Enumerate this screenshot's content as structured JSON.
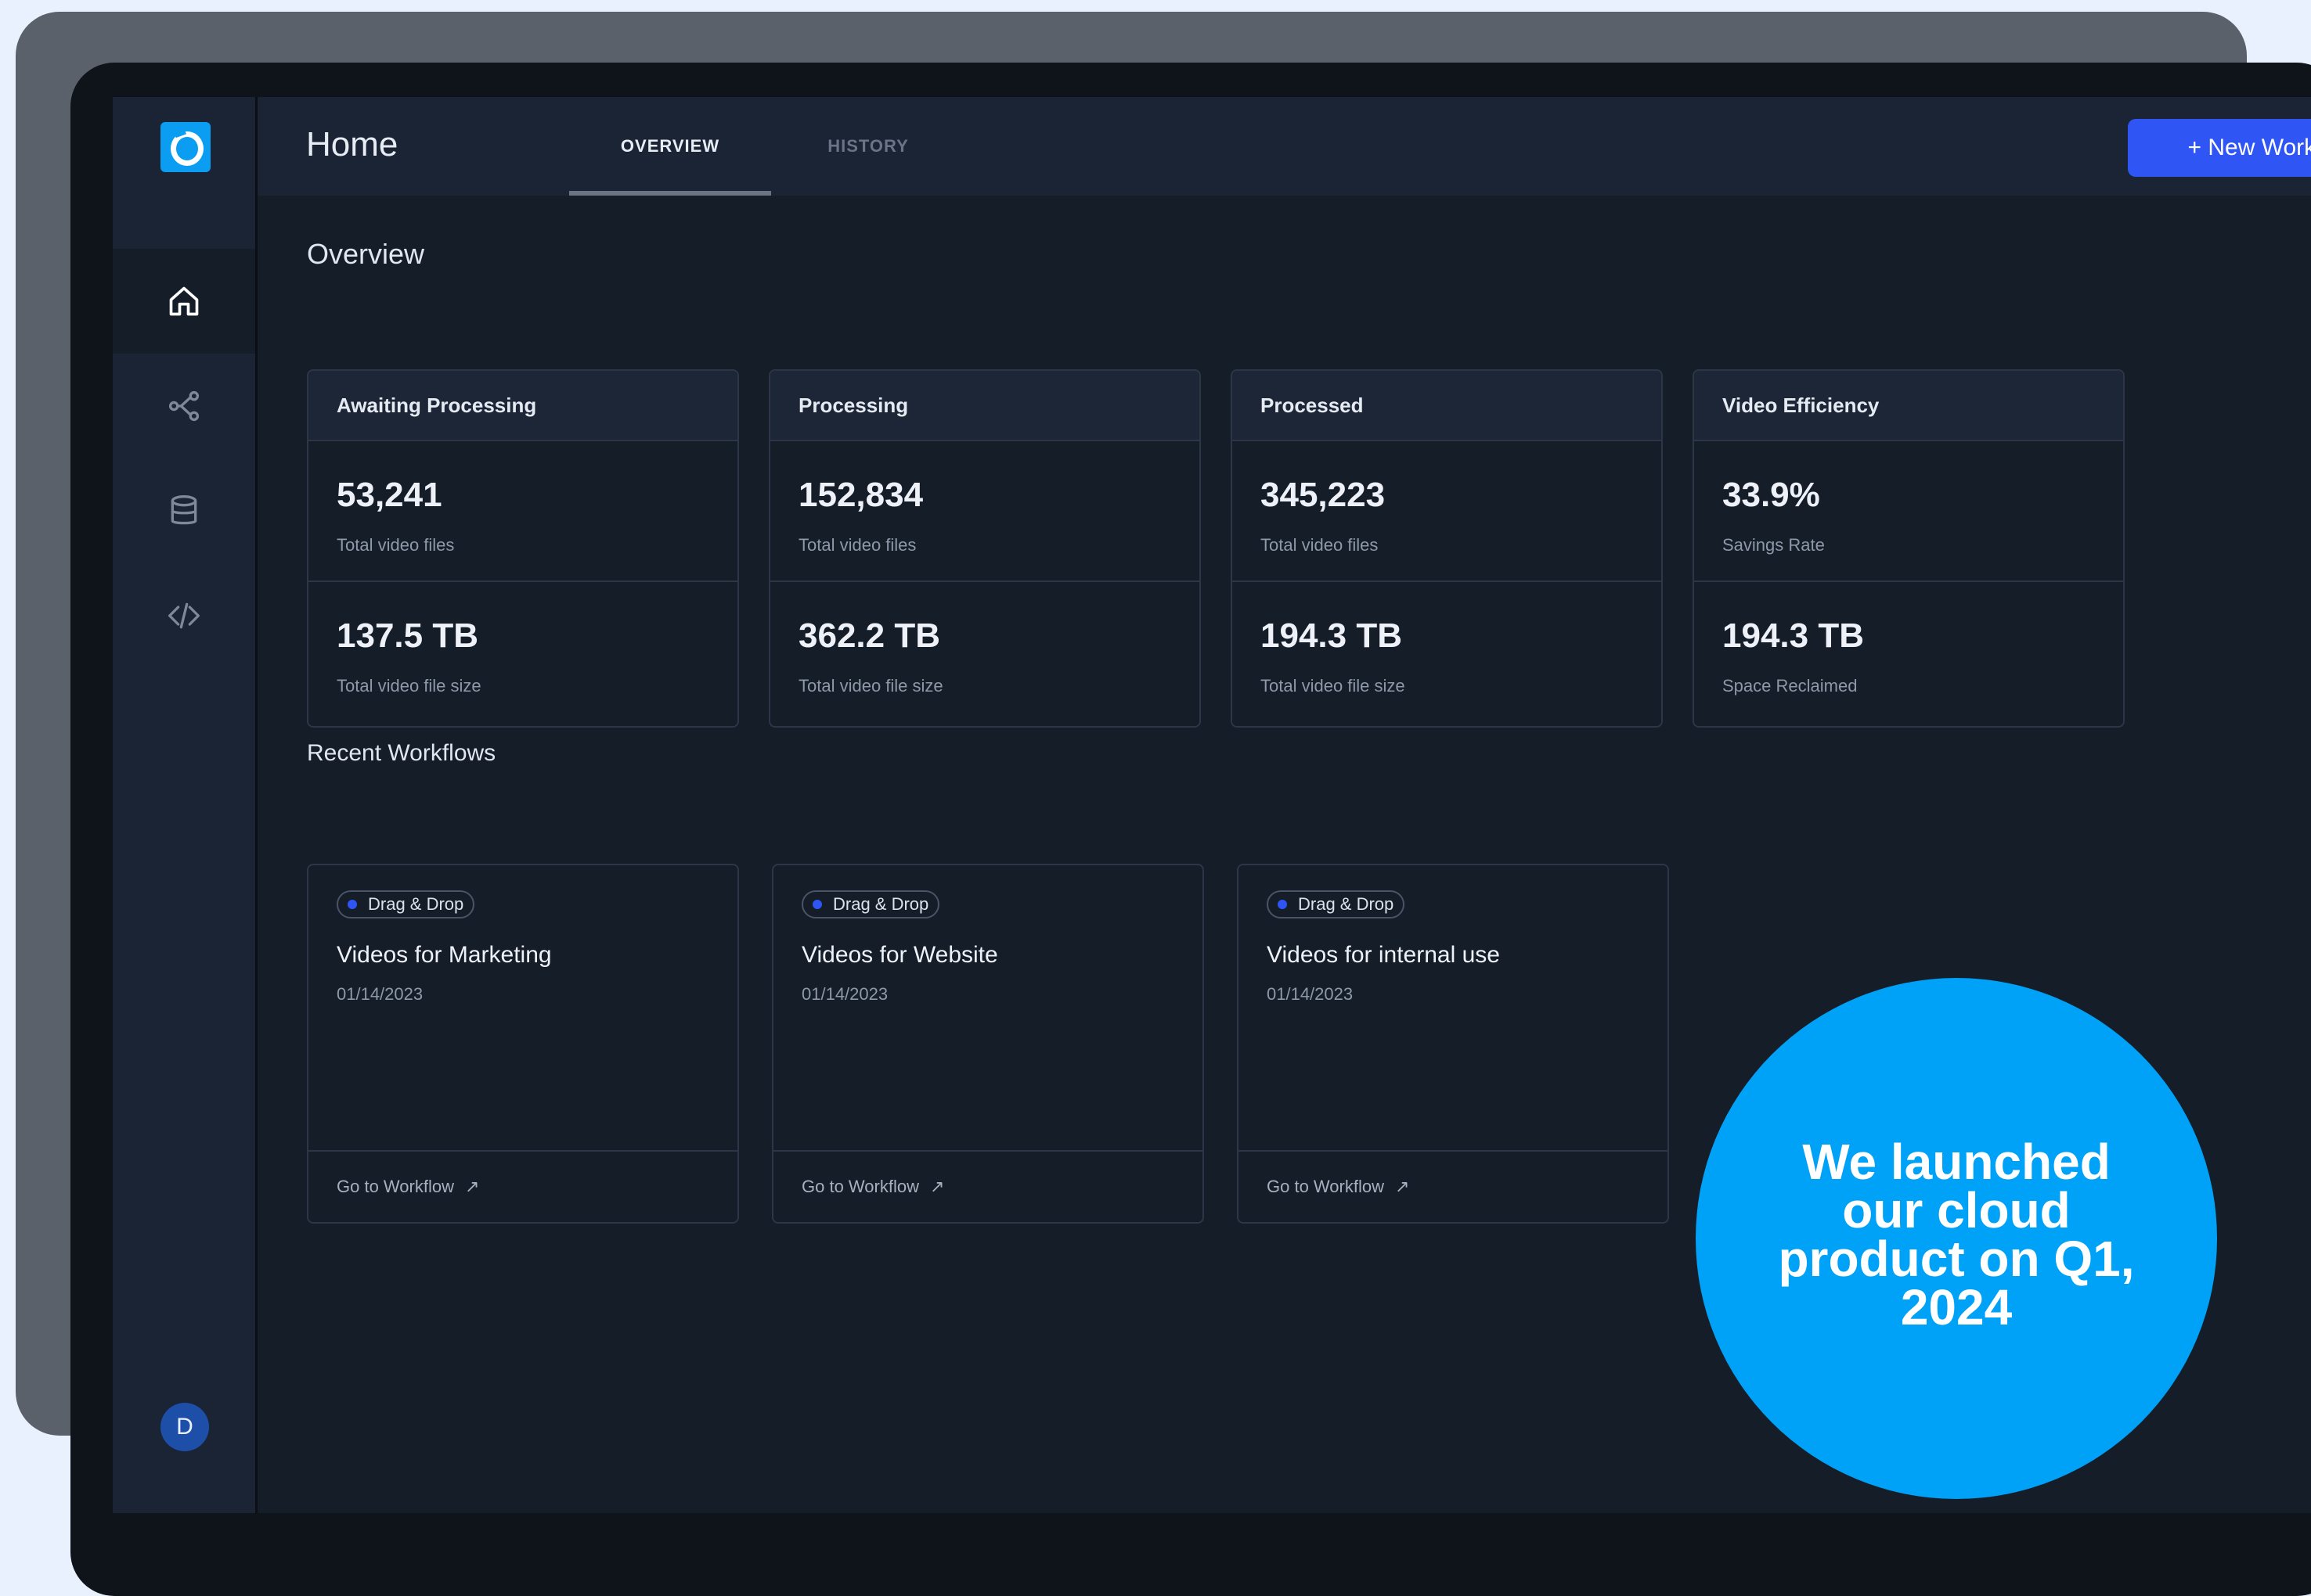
{
  "header": {
    "title": "Home",
    "tabs": [
      {
        "label": "OVERVIEW",
        "active": true
      },
      {
        "label": "HISTORY",
        "active": false
      }
    ],
    "new_button": "+ New Workflow"
  },
  "sidebar": {
    "items": [
      {
        "icon": "home-icon",
        "active": true
      },
      {
        "icon": "workflow-icon",
        "active": false
      },
      {
        "icon": "database-icon",
        "active": false
      },
      {
        "icon": "code-icon",
        "active": false
      }
    ],
    "avatar_initial": "D"
  },
  "overview": {
    "title": "Overview",
    "cards": [
      {
        "header": "Awaiting Processing",
        "value1": "53,241",
        "label1": "Total video files",
        "value2": "137.5 TB",
        "label2": "Total video file size"
      },
      {
        "header": "Processing",
        "value1": "152,834",
        "label1": "Total video files",
        "value2": "362.2 TB",
        "label2": "Total video file size"
      },
      {
        "header": "Processed",
        "value1": "345,223",
        "label1": "Total video files",
        "value2": "194.3 TB",
        "label2": "Total video file size"
      },
      {
        "header": "Video Efficiency",
        "value1": "33.9%",
        "label1": "Savings Rate",
        "value2": "194.3 TB",
        "label2": "Space Reclaimed"
      }
    ]
  },
  "recent": {
    "title": "Recent Workflows",
    "cards": [
      {
        "badge": "Drag & Drop",
        "title": "Videos for Marketing",
        "date": "01/14/2023",
        "link": "Go to Workflow"
      },
      {
        "badge": "Drag & Drop",
        "title": "Videos for Website",
        "date": "01/14/2023",
        "link": "Go to Workflow"
      },
      {
        "badge": "Drag & Drop",
        "title": "Videos for internal use",
        "date": "01/14/2023",
        "link": "Go to Workflow"
      }
    ]
  },
  "promo": {
    "text": "We launched our cloud product on Q1, 2024"
  },
  "colors": {
    "accent": "#2f56f5",
    "promo": "#00a2f8",
    "background": "#151d29"
  }
}
